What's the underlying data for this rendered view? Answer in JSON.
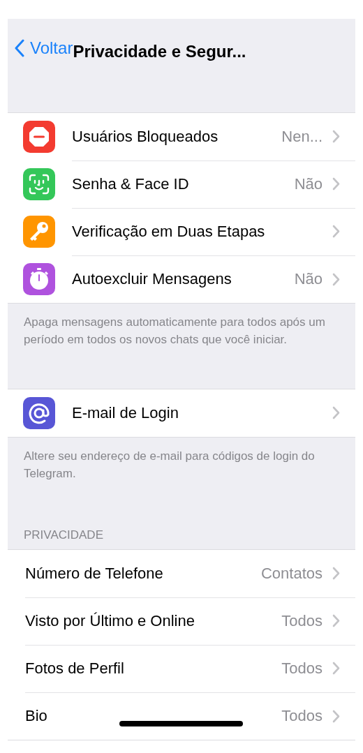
{
  "nav": {
    "back": "Voltar",
    "title": "Privacidade e Segur..."
  },
  "security": [
    {
      "kind": "blocked",
      "color": "#f33b30",
      "label": "Usuários Bloqueados",
      "value": "Nen..."
    },
    {
      "kind": "face",
      "color": "#34c759",
      "label": "Senha & Face ID",
      "value": "Não"
    },
    {
      "kind": "key",
      "color": "#ff9500",
      "label": "Verificação em Duas Etapas"
    },
    {
      "kind": "timer",
      "color": "#af52de",
      "label": "Autoexcluir Mensagens",
      "value": "Não"
    }
  ],
  "security_footer": "Apaga mensagens automaticamente para todos após um período em todos os novos chats que você iniciar.",
  "login": [
    {
      "kind": "at",
      "color": "#5856d6",
      "label": "E-mail de Login"
    }
  ],
  "login_footer": "Altere seu endereço de e-mail para códigos de login do Telegram.",
  "privacy_header": "PRIVACIDADE",
  "privacy": [
    {
      "label": "Número de Telefone",
      "value": "Contatos"
    },
    {
      "label": "Visto por Último e Online",
      "value": "Todos"
    },
    {
      "label": "Fotos de Perfil",
      "value": "Todos"
    },
    {
      "label": "Bio",
      "value": "Todos"
    }
  ]
}
